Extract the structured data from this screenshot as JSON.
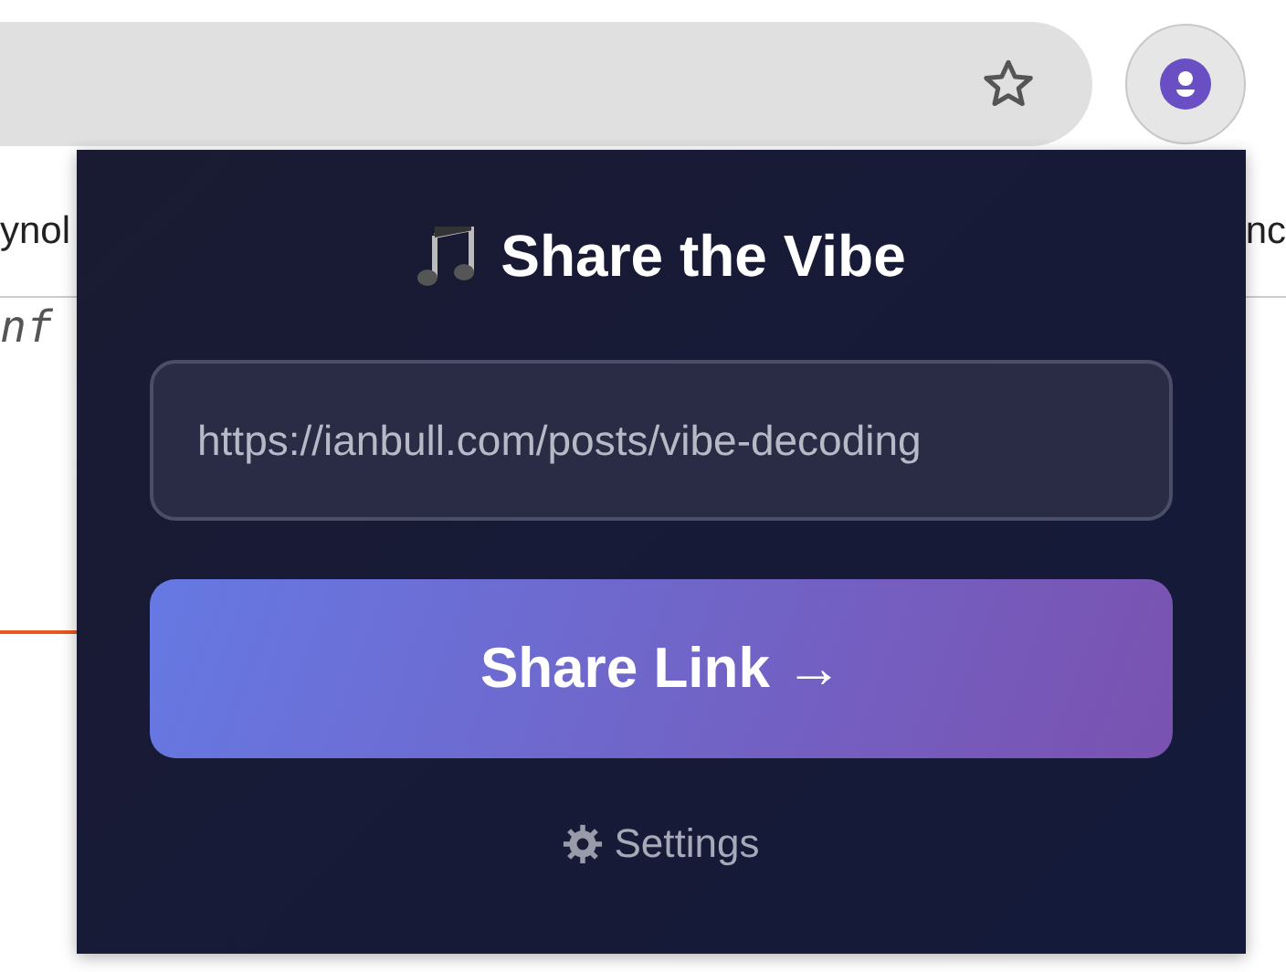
{
  "browser": {
    "bookmarks_left": "ynol",
    "bookmarks_right": "nc",
    "page_text": "nf"
  },
  "popup": {
    "title": "Share the Vibe",
    "url_field": {
      "value": "https://ianbull.com/posts/vibe-decoding"
    },
    "share_button": "Share Link →",
    "settings_link": "Settings"
  }
}
